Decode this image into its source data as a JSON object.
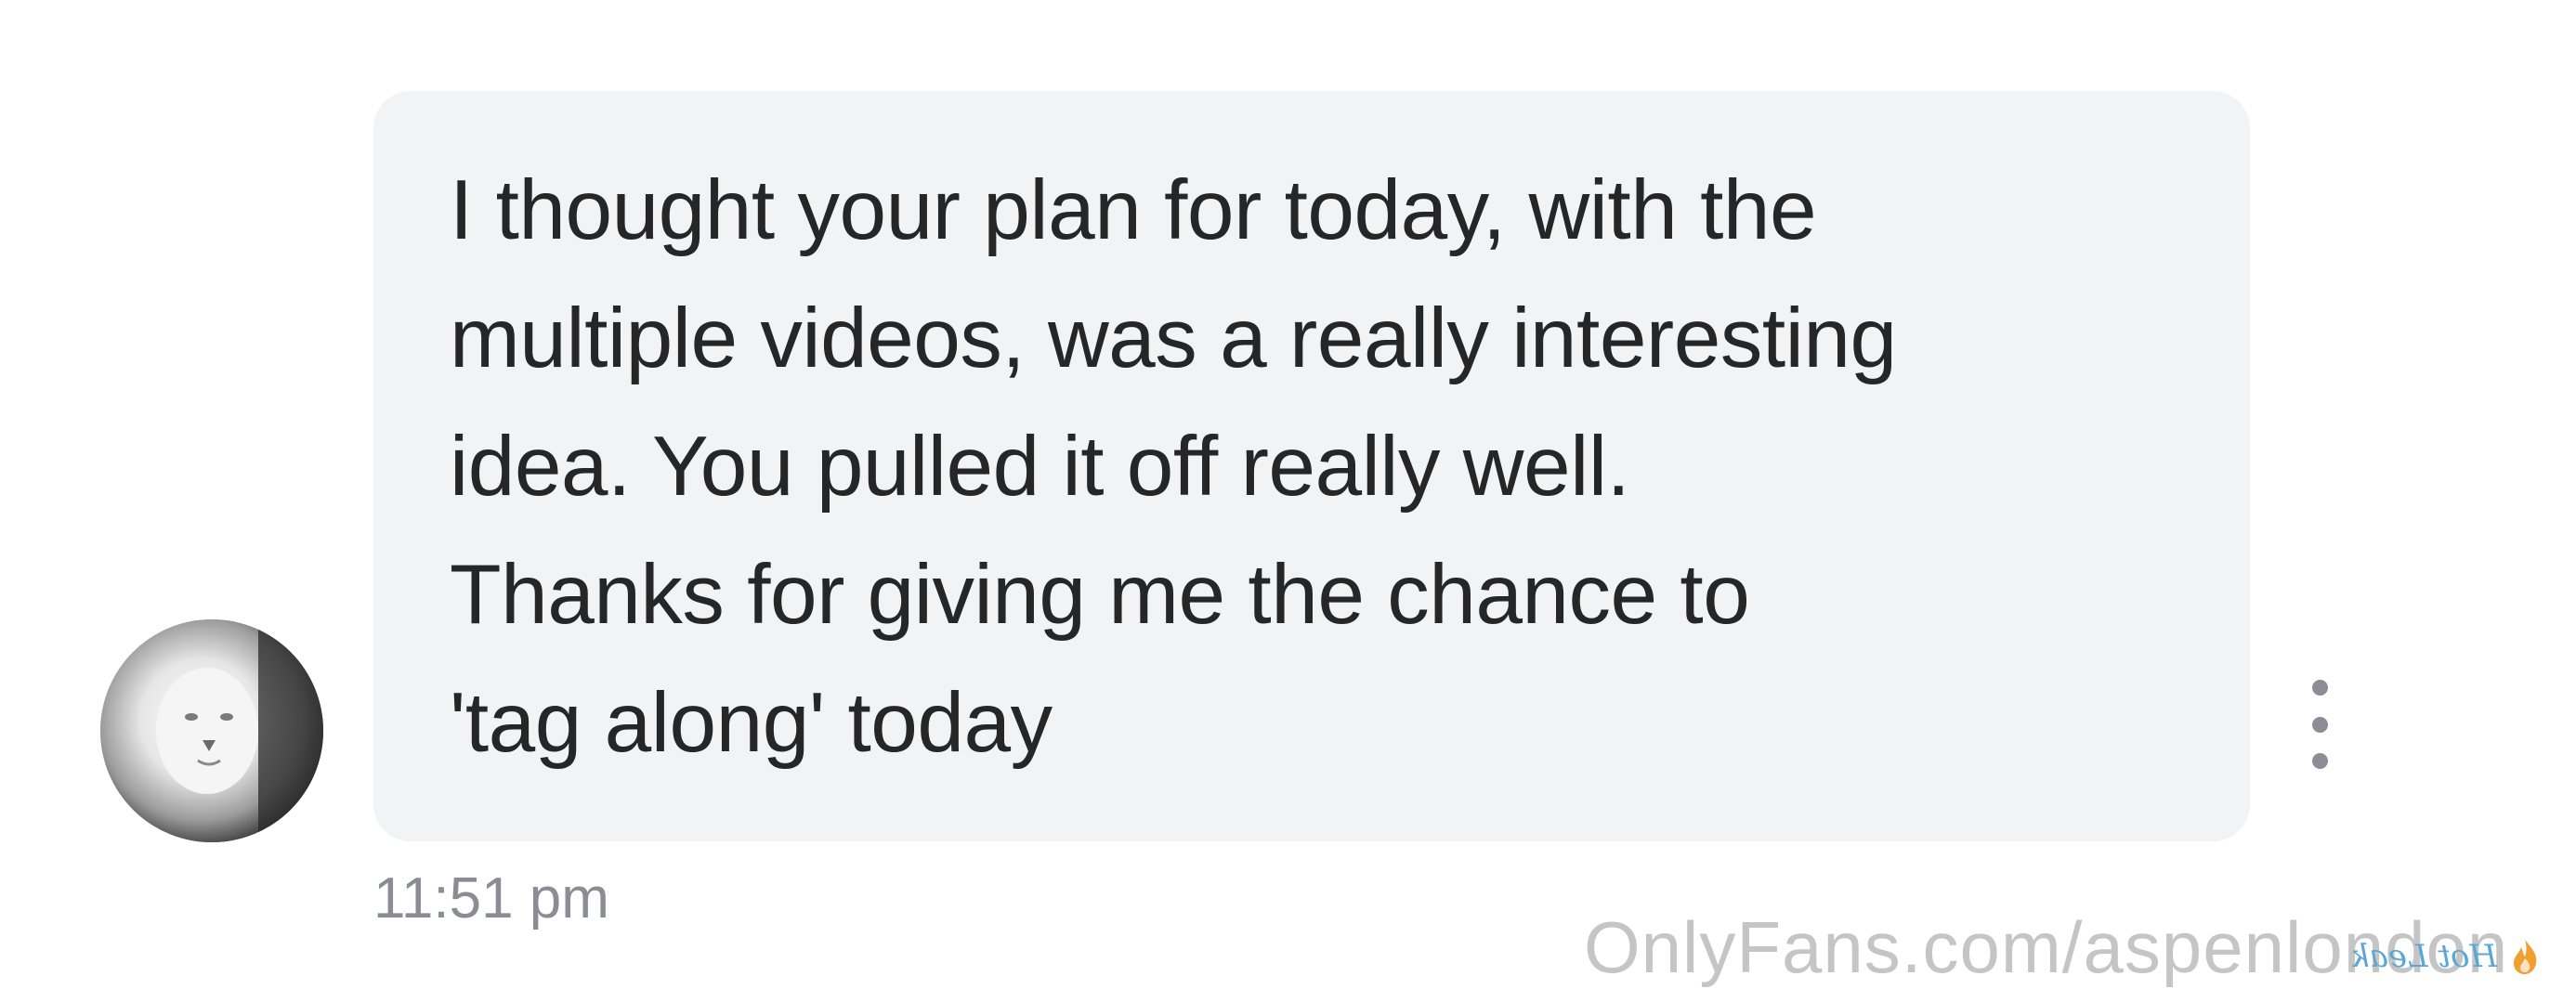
{
  "message": {
    "text": "I thought your plan for today, with the\nmultiple videos, was a really interesting\nidea. You pulled it off really well.\nThanks for giving me the chance to\n'tag along' today",
    "time": "11:51 pm"
  },
  "sender": {
    "avatar_icon": "lion-avatar-icon"
  },
  "actions": {
    "more_icon": "more-vertical-icon"
  },
  "watermark": {
    "text": "OnlyFans.com/aspenlondon",
    "logo_text": "Hot Leak"
  },
  "colors": {
    "bubble": "#f2f3f5",
    "text": "#262626",
    "muted": "#8a8d93",
    "logo_accent": "#f0a030"
  }
}
